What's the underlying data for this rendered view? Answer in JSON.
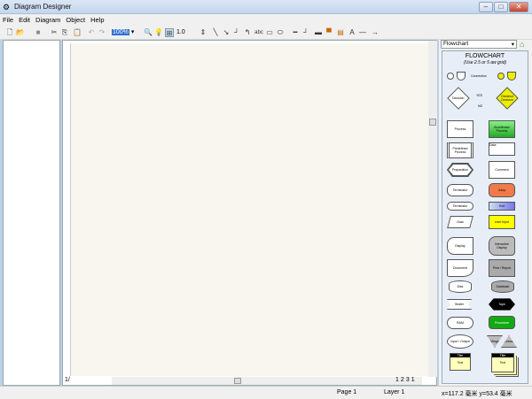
{
  "window": {
    "title": "Diagram Designer"
  },
  "menu": [
    "File",
    "Edit",
    "Diagram",
    "Object",
    "Help"
  ],
  "toolbar": {
    "zoom": "100%",
    "line_width": "1.0",
    "text_tool": "abc"
  },
  "stencil": {
    "selected": "Flowchart",
    "title": "FLOWCHART",
    "subtitle": "(Use 2.5 or 5 aw grid)",
    "shapes": [
      "Connection",
      "Decision",
      "YES",
      "NO",
      "Dividend Decision",
      "Process",
      "Accelerator Process",
      "Predefined Process",
      "Data",
      "Preparation",
      "Comment",
      "Terminator",
      "Jump",
      "Terminator",
      "Exit",
      "Data",
      "User Input",
      "Display",
      "Interactive Display",
      "Document",
      "Print / Report",
      "Disk",
      "Database",
      "Sealer",
      "Tape",
      "RAM",
      "Procedure",
      "Input / Output",
      "Merge",
      "Extract",
      "Title",
      "Text",
      "Title",
      "Text"
    ]
  },
  "tabs": [
    "1",
    "2",
    "3",
    "1"
  ],
  "status": {
    "page": "Page 1",
    "layer": "Layer 1",
    "coords": "x=117.2 毫米  y=53.4 毫米"
  }
}
